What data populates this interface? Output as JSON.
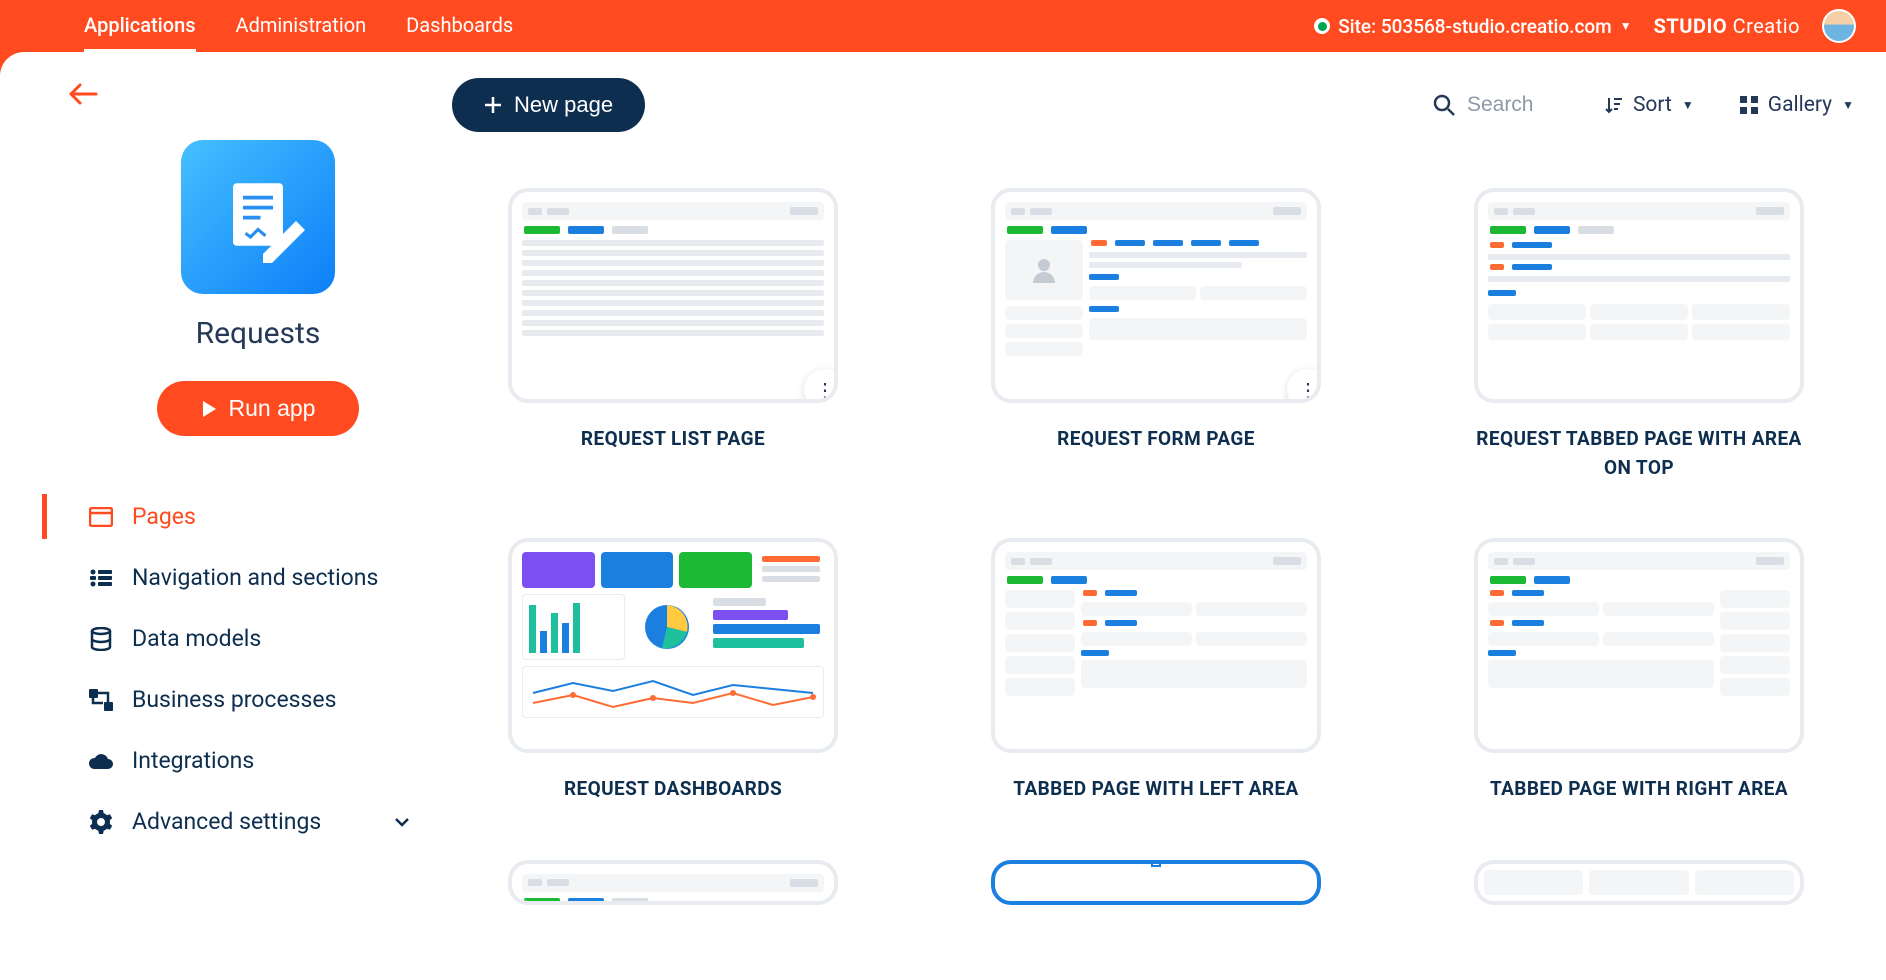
{
  "topbar": {
    "tabs": [
      "Applications",
      "Administration",
      "Dashboards"
    ],
    "active_tab": 0,
    "site_label": "Site: 503568-studio.creatio.com",
    "brand_prefix": "STUDIO",
    "brand_suffix": "Creatio"
  },
  "sidebar": {
    "app_name": "Requests",
    "run_label": "Run app",
    "nav": [
      {
        "label": "Pages",
        "icon": "page-icon",
        "active": true
      },
      {
        "label": "Navigation and sections",
        "icon": "list-icon"
      },
      {
        "label": "Data models",
        "icon": "database-icon"
      },
      {
        "label": "Business processes",
        "icon": "process-icon"
      },
      {
        "label": "Integrations",
        "icon": "cloud-icon"
      },
      {
        "label": "Advanced settings",
        "icon": "gear-icon",
        "expandable": true
      }
    ]
  },
  "toolbar": {
    "new_label": "New page",
    "search_placeholder": "Search",
    "sort_label": "Sort",
    "view_label": "Gallery"
  },
  "cards": [
    {
      "title": "REQUEST LIST PAGE",
      "thumb": "list",
      "more": true
    },
    {
      "title": "REQUEST FORM PAGE",
      "thumb": "form",
      "more": true
    },
    {
      "title": "REQUEST TABBED PAGE WITH AREA ON TOP",
      "thumb": "tabtop"
    },
    {
      "title": "REQUEST DASHBOARDS",
      "thumb": "dash"
    },
    {
      "title": "TABBED PAGE WITH LEFT AREA",
      "thumb": "tableft"
    },
    {
      "title": "TABBED PAGE WITH RIGHT AREA",
      "thumb": "tabright"
    },
    {
      "title": "",
      "thumb": "list2"
    },
    {
      "title": "",
      "thumb": "blank",
      "selected": true
    },
    {
      "title": "",
      "thumb": "cols"
    }
  ]
}
